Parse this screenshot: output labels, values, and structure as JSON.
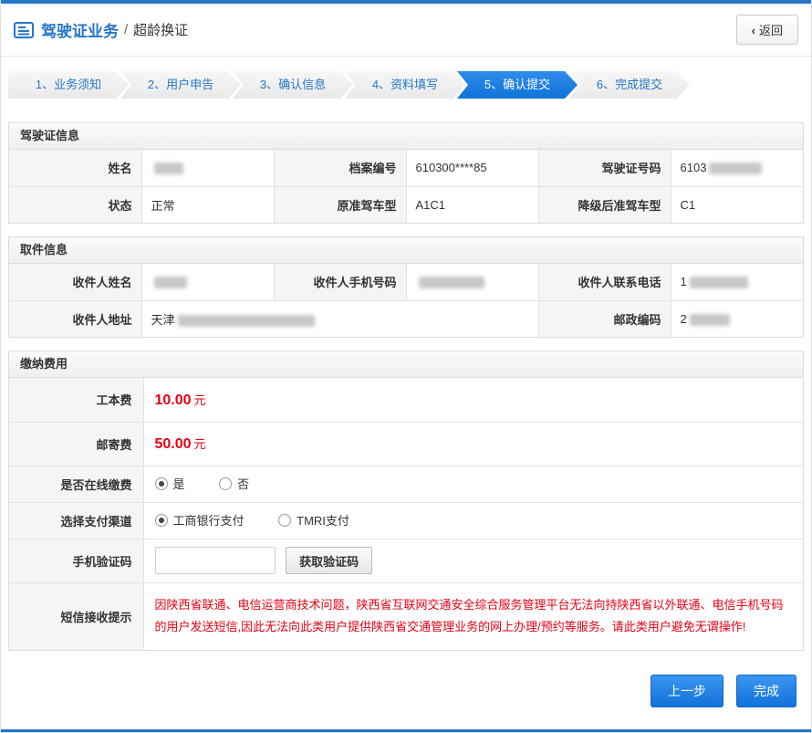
{
  "header": {
    "title": "驾驶证业务",
    "separator": "/",
    "subtitle": "超龄换证",
    "back_chevron": "‹",
    "back": "返回"
  },
  "steps": [
    "1、业务须知",
    "2、用户申告",
    "3、确认信息",
    "4、资料填写",
    "5、确认提交",
    "6、完成提交"
  ],
  "license": {
    "title": "驾驶证信息",
    "name_label": "姓名",
    "file_label": "档案编号",
    "file_value": "610300****85",
    "number_label": "驾驶证号码",
    "number_value": "6103",
    "status_label": "状态",
    "status_value": "正常",
    "orig_label": "原准驾车型",
    "orig_value": "A1C1",
    "downgrade_label": "降级后准驾车型",
    "downgrade_value": "C1"
  },
  "pickup": {
    "title": "取件信息",
    "name_label": "收件人姓名",
    "mobile_label": "收件人手机号码",
    "tel_label": "收件人联系电话",
    "tel_value": "1",
    "address_label": "收件人地址",
    "address_value": "天津",
    "zip_label": "邮政编码",
    "zip_value": "2"
  },
  "fees": {
    "title": "缴纳费用",
    "cost_label": "工本费",
    "cost_value": "10.00",
    "cost_unit": "元",
    "postage_label": "邮寄费",
    "postage_value": "50.00",
    "postage_unit": "元",
    "online_label": "是否在线缴费",
    "online_yes": "是",
    "online_no": "否",
    "channel_label": "选择支付渠道",
    "channel_icbc": "工商银行支付",
    "channel_tmri": "TMRI支付",
    "captcha_label": "手机验证码",
    "captcha_button": "获取验证码",
    "sms_label": "短信接收提示",
    "sms_notice": "因陕西省联通、电信运营商技术问题，陕西省互联网交通安全综合服务管理平台无法向持陕西省以外联通、电信手机号码的用户发送短信,因此无法向此类用户提供陕西省交通管理业务的网上办理/预约等服务。请此类用户避免无谓操作!"
  },
  "actions": {
    "prev": "上一步",
    "finish": "完成"
  },
  "colors": {
    "accent": "#2577c8",
    "step_active": "#1581e6",
    "danger": "#e60012"
  }
}
